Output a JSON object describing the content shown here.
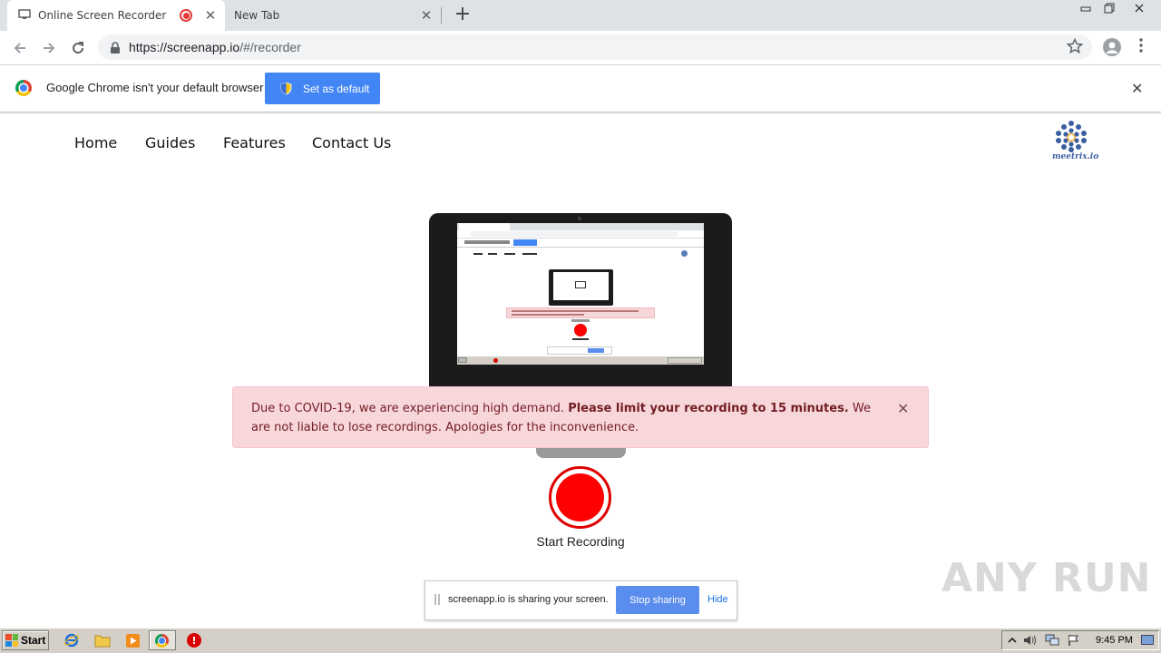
{
  "browser": {
    "tabs": [
      {
        "title": "Online Screen Recorder",
        "recording": true
      },
      {
        "title": "New Tab"
      }
    ],
    "tab_close_glyph": "✕",
    "new_tab_glyph": "+",
    "url_host": "https://screenapp.io",
    "url_path": "/#/recorder",
    "nav_icons": {
      "back": "arrow-left",
      "forward": "arrow-right",
      "reload": "reload",
      "star": "star",
      "menu": "kebab"
    }
  },
  "infobar": {
    "message": "Google Chrome isn't your default browser",
    "button_label": "Set as default",
    "close_glyph": "✕"
  },
  "site": {
    "nav": [
      "Home",
      "Guides",
      "Features",
      "Contact Us"
    ],
    "logo_text": "meetrix.io"
  },
  "alert": {
    "text_before": "Due to COVID-19, we are experiencing high demand. ",
    "text_bold": "Please limit your recording to 15 minutes.",
    "text_after": " We are not liable to lose recordings. Apologies for the inconvenience.",
    "close_glyph": "✕",
    "colors": {
      "background": "#f8d7da",
      "text": "#721c24"
    }
  },
  "recorder": {
    "button_label": "Start Recording",
    "accent": "#ff0000"
  },
  "share_bar": {
    "message": "screenapp.io is sharing your screen.",
    "stop_label": "Stop sharing",
    "hide_label": "Hide"
  },
  "watermark": "ANY RUN",
  "taskbar": {
    "start_label": "Start",
    "clock": "9:45 PM"
  }
}
